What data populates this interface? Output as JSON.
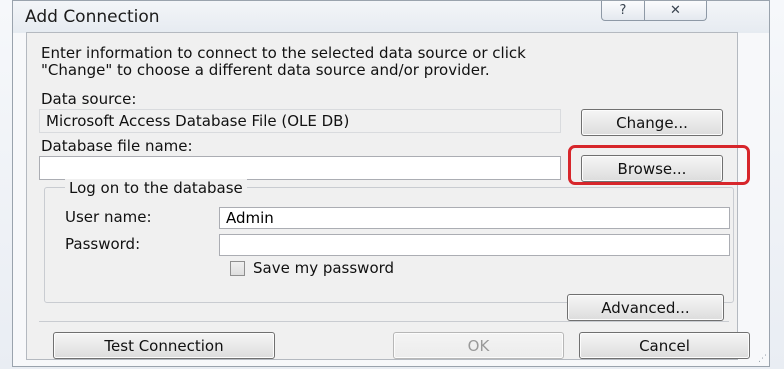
{
  "dialog": {
    "title": "Add Connection",
    "help_glyph": "?",
    "close_glyph": "✕"
  },
  "intro_text": "Enter information to connect to the selected data source or click\n\"Change\" to choose a different data source and/or provider.",
  "data_source": {
    "label": "Data source:",
    "value": "Microsoft Access Database File (OLE DB)",
    "change_label": "Change..."
  },
  "database_file": {
    "label": "Database file name:",
    "value": "",
    "browse_label": "Browse..."
  },
  "logon": {
    "legend": "Log on to the database",
    "user_label": "User name:",
    "user_value": "Admin",
    "password_label": "Password:",
    "password_value": "",
    "save_password_label": "Save my password",
    "save_password_checked": false
  },
  "buttons": {
    "advanced": "Advanced...",
    "test_connection": "Test Connection",
    "ok": "OK",
    "cancel": "Cancel"
  },
  "colors": {
    "highlight": "#d7262b"
  }
}
